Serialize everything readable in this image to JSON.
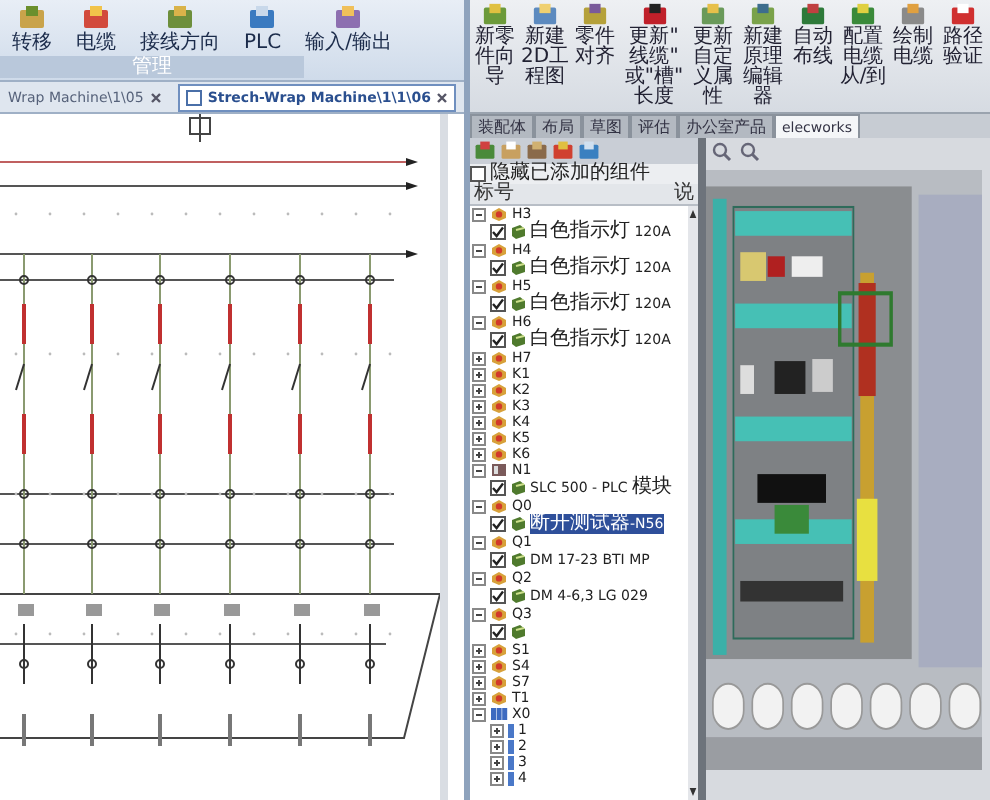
{
  "left_ribbon": {
    "buttons": [
      {
        "label": "转移"
      },
      {
        "label": "电缆"
      },
      {
        "label": "接线方向"
      },
      {
        "label": "PLC"
      },
      {
        "label": "输入/输出"
      }
    ],
    "group_label": "管理"
  },
  "document_tabs": [
    {
      "label": "Wrap Machine\\1\\05",
      "selected": false
    },
    {
      "label": "Strech-Wrap Machine\\1\\1\\06",
      "selected": true
    }
  ],
  "right_ribbon": {
    "buttons": [
      {
        "label": "新零件向导"
      },
      {
        "label": "新建2D工程图"
      },
      {
        "label": "零件对齐"
      },
      {
        "label": "更新\"线缆\"或\"槽\"长度"
      },
      {
        "label": "更新自定义属性"
      },
      {
        "label": "新建原理编辑器"
      },
      {
        "label": "自动布线"
      },
      {
        "label": "配置电缆从/到"
      },
      {
        "label": "绘制电缆"
      },
      {
        "label": "路径验证"
      }
    ]
  },
  "cad_tabs": [
    {
      "label": "装配体",
      "selected": false
    },
    {
      "label": "布局",
      "selected": false
    },
    {
      "label": "草图",
      "selected": false
    },
    {
      "label": "评估",
      "selected": false
    },
    {
      "label": "办公室产品",
      "selected": false
    },
    {
      "label": "elecworks",
      "selected": true
    }
  ],
  "tree": {
    "hide_added": {
      "label": "隐藏已添加的组件",
      "checked": false
    },
    "column_1": "标号",
    "column_2": "说",
    "items": [
      {
        "label": "H3",
        "kind": "component",
        "expanded": true,
        "children": [
          {
            "label": "白色指示灯 120A",
            "checked": true,
            "selected": false
          }
        ]
      },
      {
        "label": "H4",
        "kind": "component",
        "expanded": true,
        "children": [
          {
            "label": "白色指示灯 120A",
            "checked": true,
            "selected": false
          }
        ]
      },
      {
        "label": "H5",
        "kind": "component",
        "expanded": true,
        "children": [
          {
            "label": "白色指示灯 120A",
            "checked": true,
            "selected": false
          }
        ]
      },
      {
        "label": "H6",
        "kind": "component",
        "expanded": true,
        "children": [
          {
            "label": "白色指示灯 120A",
            "checked": true,
            "selected": false
          }
        ]
      },
      {
        "label": "H7",
        "kind": "component",
        "expanded": false
      },
      {
        "label": "K1",
        "kind": "component",
        "expanded": false
      },
      {
        "label": "K2",
        "kind": "component",
        "expanded": false
      },
      {
        "label": "K3",
        "kind": "component",
        "expanded": false
      },
      {
        "label": "K4",
        "kind": "component",
        "expanded": false
      },
      {
        "label": "K5",
        "kind": "component",
        "expanded": false
      },
      {
        "label": "K6",
        "kind": "component",
        "expanded": false
      },
      {
        "label": "N1",
        "kind": "plc",
        "expanded": true,
        "children": [
          {
            "label": "SLC 500 - PLC 模块",
            "checked": true,
            "selected": false
          }
        ]
      },
      {
        "label": "Q0",
        "kind": "component",
        "expanded": true,
        "children": [
          {
            "label": "断开测试器-N56",
            "checked": true,
            "selected": true
          }
        ]
      },
      {
        "label": "Q1",
        "kind": "component",
        "expanded": true,
        "children": [
          {
            "label": "DM 17-23 BTI MP",
            "checked": true,
            "selected": false
          }
        ]
      },
      {
        "label": "Q2",
        "kind": "component",
        "expanded": true,
        "children": [
          {
            "label": "DM 4-6,3 LG 029",
            "checked": true,
            "selected": false
          }
        ]
      },
      {
        "label": "Q3",
        "kind": "component",
        "expanded": true,
        "children": [
          {
            "checked": true,
            "selected": false
          }
        ]
      },
      {
        "label": "S1",
        "kind": "component",
        "expanded": false
      },
      {
        "label": "S4",
        "kind": "component",
        "expanded": false
      },
      {
        "label": "S7",
        "kind": "component",
        "expanded": false
      },
      {
        "label": "T1",
        "kind": "component",
        "expanded": false
      },
      {
        "label": "X0",
        "kind": "terminal",
        "expanded": true,
        "children": [
          {
            "label": "1",
            "kind": "pin",
            "expanded": false
          },
          {
            "label": "2",
            "kind": "pin",
            "expanded": false
          },
          {
            "label": "3",
            "kind": "pin",
            "expanded": false
          },
          {
            "label": "4",
            "kind": "pin",
            "expanded": false
          }
        ]
      }
    ]
  }
}
